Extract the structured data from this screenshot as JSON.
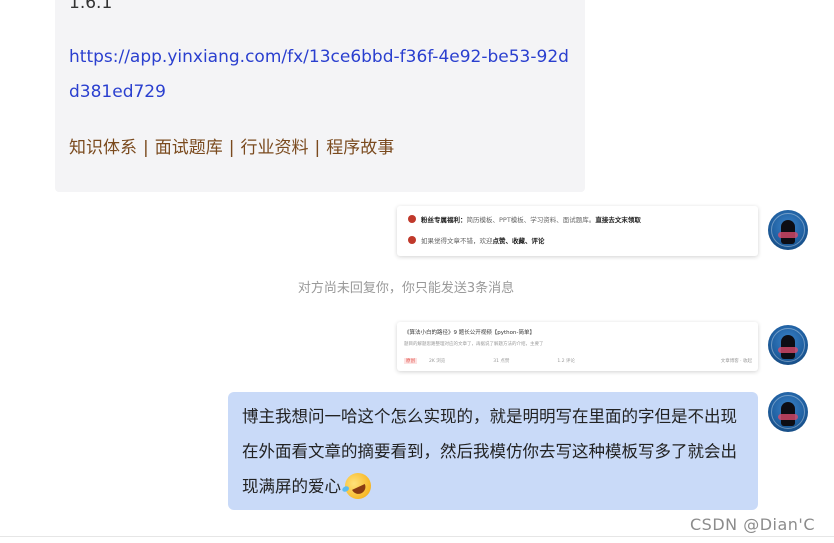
{
  "incoming": {
    "cutoff_text": "1.6.1 ",
    "link": "https://app.yinxiang.com/fx/13ce6bbd-f36f-4e92-be53-92dd381ed729",
    "tags": [
      "知识体系",
      "面试题库",
      "行业资料",
      "程序故事"
    ],
    "separator": "|"
  },
  "card1": {
    "row1_bold": "粉丝专属福利：",
    "row1_text": "简历模板、PPT模板、学习资料、面试题库。",
    "row1_tail": "直接去文末领取",
    "row2_text": "如果觉得文章不错，欢迎",
    "row2_tail": "点赞、收藏、评论"
  },
  "system_notice": "对方尚未回复你，你只能发送3条消息",
  "card2": {
    "title": "《算法小白的路径》9 题长公开视频【python-简单】",
    "desc": "题目的解题思路整理对应的文章了，再据说了解题方法的介绍，主要了",
    "tag": "原创",
    "meta": [
      "2K 浏览",
      "31 点赞",
      "1.2 评论"
    ],
    "meta_right": "文章博客 ‧ 收起"
  },
  "outgoing": {
    "text": "博主我想问一哈这个怎么实现的，就是明明写在里面的字但是不出现在外面看文章的摘要看到，然后我模仿你去写这种模板写多了就会出现满屏的爱心"
  },
  "watermark": "CSDN @Dian'C",
  "colors": {
    "incoming_bg": "#f4f4f6",
    "outgoing_bg": "#c9daf8",
    "link": "#2a3fcf",
    "tag_text": "#7a4a1e"
  }
}
